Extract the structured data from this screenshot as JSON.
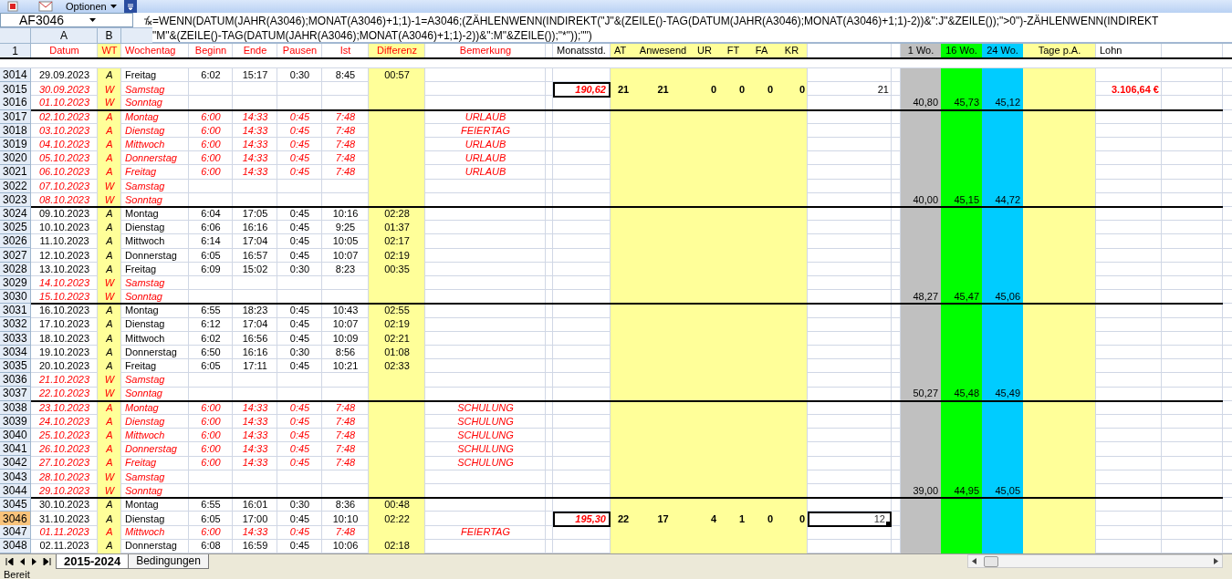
{
  "toolbar": {
    "menu_label": "Optionen"
  },
  "name_box": "AF3046",
  "formula_lines": [
    "=WENN(DATUM(JAHR(A3046);MONAT(A3046)+1;1)-1=A3046;(ZÄHLENWENN(INDIREKT(\"J\"&(ZEILE()-TAG(DATUM(JAHR(A3046);MONAT(A3046)+1;1)-2))&\":J\"&ZEILE());\">0\")-ZÄHLENWENN(INDIREKT",
    "\"M\"&(ZEILE()-TAG(DATUM(JAHR(A3046);MONAT(A3046)+1;1)-2))&\":M\"&ZEILE());\"*\"));\"\")"
  ],
  "column_letters": [
    "A",
    "B"
  ],
  "header_row": "1",
  "headers": [
    "Datum",
    "WT",
    "Wochentag",
    "Beginn",
    "Ende",
    "Pausen",
    "Ist",
    "Differenz",
    "Bemerkung",
    "Monatsstd.",
    "AT",
    "Anwesend",
    "UR",
    "FT",
    "FA",
    "KR",
    "1 Wo.",
    "16 Wo.",
    "24 Wo.",
    "Tage p.A.",
    "Lohn"
  ],
  "rows": [
    {
      "row": "3014",
      "date": "29.09.2023",
      "wt": "A",
      "day": "Freitag",
      "start": "6:02",
      "end": "15:17",
      "break": "0:30",
      "actual": "8:45",
      "diff": "00:57",
      "kind": "work",
      "week_end": false,
      "selected": false
    },
    {
      "row": "3015",
      "date": "30.09.2023",
      "wt": "W",
      "day": "Samstag",
      "kind": "weekend",
      "week_end": false,
      "selected": false,
      "month": {
        "hours": "190,62",
        "at": "21",
        "present": "21",
        "ur": "0",
        "ft": "0",
        "fa": "0",
        "kr": "0",
        "days": "21",
        "wage": "3.106,64 €"
      }
    },
    {
      "row": "3016",
      "date": "01.10.2023",
      "wt": "W",
      "day": "Sonntag",
      "kind": "weekend",
      "week_end": true,
      "selected": false,
      "week": {
        "w1": "40,80",
        "w16": "45,73",
        "w24": "45,12"
      }
    },
    {
      "row": "3017",
      "date": "02.10.2023",
      "wt": "A",
      "day": "Montag",
      "start": "6:00",
      "end": "14:33",
      "break": "0:45",
      "actual": "7:48",
      "note": "URLAUB",
      "kind": "absence",
      "week_end": false,
      "selected": false
    },
    {
      "row": "3018",
      "date": "03.10.2023",
      "wt": "A",
      "day": "Dienstag",
      "start": "6:00",
      "end": "14:33",
      "break": "0:45",
      "actual": "7:48",
      "note": "FEIERTAG",
      "kind": "absence",
      "week_end": false,
      "selected": false
    },
    {
      "row": "3019",
      "date": "04.10.2023",
      "wt": "A",
      "day": "Mittwoch",
      "start": "6:00",
      "end": "14:33",
      "break": "0:45",
      "actual": "7:48",
      "note": "URLAUB",
      "kind": "absence",
      "week_end": false,
      "selected": false
    },
    {
      "row": "3020",
      "date": "05.10.2023",
      "wt": "A",
      "day": "Donnerstag",
      "start": "6:00",
      "end": "14:33",
      "break": "0:45",
      "actual": "7:48",
      "note": "URLAUB",
      "kind": "absence",
      "week_end": false,
      "selected": false
    },
    {
      "row": "3021",
      "date": "06.10.2023",
      "wt": "A",
      "day": "Freitag",
      "start": "6:00",
      "end": "14:33",
      "break": "0:45",
      "actual": "7:48",
      "note": "URLAUB",
      "kind": "absence",
      "week_end": false,
      "selected": false
    },
    {
      "row": "3022",
      "date": "07.10.2023",
      "wt": "W",
      "day": "Samstag",
      "kind": "weekend",
      "week_end": false,
      "selected": false
    },
    {
      "row": "3023",
      "date": "08.10.2023",
      "wt": "W",
      "day": "Sonntag",
      "kind": "weekend",
      "week_end": true,
      "selected": false,
      "week": {
        "w1": "40,00",
        "w16": "45,15",
        "w24": "44,72"
      }
    },
    {
      "row": "3024",
      "date": "09.10.2023",
      "wt": "A",
      "day": "Montag",
      "start": "6:04",
      "end": "17:05",
      "break": "0:45",
      "actual": "10:16",
      "diff": "02:28",
      "kind": "work",
      "week_end": false,
      "selected": false
    },
    {
      "row": "3025",
      "date": "10.10.2023",
      "wt": "A",
      "day": "Dienstag",
      "start": "6:06",
      "end": "16:16",
      "break": "0:45",
      "actual": "9:25",
      "diff": "01:37",
      "kind": "work",
      "week_end": false,
      "selected": false
    },
    {
      "row": "3026",
      "date": "11.10.2023",
      "wt": "A",
      "day": "Mittwoch",
      "start": "6:14",
      "end": "17:04",
      "break": "0:45",
      "actual": "10:05",
      "diff": "02:17",
      "kind": "work",
      "week_end": false,
      "selected": false
    },
    {
      "row": "3027",
      "date": "12.10.2023",
      "wt": "A",
      "day": "Donnerstag",
      "start": "6:05",
      "end": "16:57",
      "break": "0:45",
      "actual": "10:07",
      "diff": "02:19",
      "kind": "work",
      "week_end": false,
      "selected": false
    },
    {
      "row": "3028",
      "date": "13.10.2023",
      "wt": "A",
      "day": "Freitag",
      "start": "6:09",
      "end": "15:02",
      "break": "0:30",
      "actual": "8:23",
      "diff": "00:35",
      "kind": "work",
      "week_end": false,
      "selected": false
    },
    {
      "row": "3029",
      "date": "14.10.2023",
      "wt": "W",
      "day": "Samstag",
      "kind": "weekend",
      "week_end": false,
      "selected": false
    },
    {
      "row": "3030",
      "date": "15.10.2023",
      "wt": "W",
      "day": "Sonntag",
      "kind": "weekend",
      "week_end": true,
      "selected": false,
      "week": {
        "w1": "48,27",
        "w16": "45,47",
        "w24": "45,06"
      }
    },
    {
      "row": "3031",
      "date": "16.10.2023",
      "wt": "A",
      "day": "Montag",
      "start": "6:55",
      "end": "18:23",
      "break": "0:45",
      "actual": "10:43",
      "diff": "02:55",
      "kind": "work",
      "week_end": false,
      "selected": false
    },
    {
      "row": "3032",
      "date": "17.10.2023",
      "wt": "A",
      "day": "Dienstag",
      "start": "6:12",
      "end": "17:04",
      "break": "0:45",
      "actual": "10:07",
      "diff": "02:19",
      "kind": "work",
      "week_end": false,
      "selected": false
    },
    {
      "row": "3033",
      "date": "18.10.2023",
      "wt": "A",
      "day": "Mittwoch",
      "start": "6:02",
      "end": "16:56",
      "break": "0:45",
      "actual": "10:09",
      "diff": "02:21",
      "kind": "work",
      "week_end": false,
      "selected": false
    },
    {
      "row": "3034",
      "date": "19.10.2023",
      "wt": "A",
      "day": "Donnerstag",
      "start": "6:50",
      "end": "16:16",
      "break": "0:30",
      "actual": "8:56",
      "diff": "01:08",
      "kind": "work",
      "week_end": false,
      "selected": false
    },
    {
      "row": "3035",
      "date": "20.10.2023",
      "wt": "A",
      "day": "Freitag",
      "start": "6:05",
      "end": "17:11",
      "break": "0:45",
      "actual": "10:21",
      "diff": "02:33",
      "kind": "work",
      "week_end": false,
      "selected": false
    },
    {
      "row": "3036",
      "date": "21.10.2023",
      "wt": "W",
      "day": "Samstag",
      "kind": "weekend",
      "week_end": false,
      "selected": false
    },
    {
      "row": "3037",
      "date": "22.10.2023",
      "wt": "W",
      "day": "Sonntag",
      "kind": "weekend",
      "week_end": true,
      "selected": false,
      "week": {
        "w1": "50,27",
        "w16": "45,48",
        "w24": "45,49"
      }
    },
    {
      "row": "3038",
      "date": "23.10.2023",
      "wt": "A",
      "day": "Montag",
      "start": "6:00",
      "end": "14:33",
      "break": "0:45",
      "actual": "7:48",
      "note": "SCHULUNG",
      "kind": "absence",
      "week_end": false,
      "selected": false
    },
    {
      "row": "3039",
      "date": "24.10.2023",
      "wt": "A",
      "day": "Dienstag",
      "start": "6:00",
      "end": "14:33",
      "break": "0:45",
      "actual": "7:48",
      "note": "SCHULUNG",
      "kind": "absence",
      "week_end": false,
      "selected": false
    },
    {
      "row": "3040",
      "date": "25.10.2023",
      "wt": "A",
      "day": "Mittwoch",
      "start": "6:00",
      "end": "14:33",
      "break": "0:45",
      "actual": "7:48",
      "note": "SCHULUNG",
      "kind": "absence",
      "week_end": false,
      "selected": false
    },
    {
      "row": "3041",
      "date": "26.10.2023",
      "wt": "A",
      "day": "Donnerstag",
      "start": "6:00",
      "end": "14:33",
      "break": "0:45",
      "actual": "7:48",
      "note": "SCHULUNG",
      "kind": "absence",
      "week_end": false,
      "selected": false
    },
    {
      "row": "3042",
      "date": "27.10.2023",
      "wt": "A",
      "day": "Freitag",
      "start": "6:00",
      "end": "14:33",
      "break": "0:45",
      "actual": "7:48",
      "note": "SCHULUNG",
      "kind": "absence",
      "week_end": false,
      "selected": false
    },
    {
      "row": "3043",
      "date": "28.10.2023",
      "wt": "W",
      "day": "Samstag",
      "kind": "weekend",
      "week_end": false,
      "selected": false
    },
    {
      "row": "3044",
      "date": "29.10.2023",
      "wt": "W",
      "day": "Sonntag",
      "kind": "weekend",
      "week_end": true,
      "selected": false,
      "week": {
        "w1": "39,00",
        "w16": "44,95",
        "w24": "45,05"
      }
    },
    {
      "row": "3045",
      "date": "30.10.2023",
      "wt": "A",
      "day": "Montag",
      "start": "6:55",
      "end": "16:01",
      "break": "0:30",
      "actual": "8:36",
      "diff": "00:48",
      "kind": "work",
      "week_end": false,
      "selected": false
    },
    {
      "row": "3046",
      "date": "31.10.2023",
      "wt": "A",
      "day": "Dienstag",
      "start": "6:05",
      "end": "17:00",
      "break": "0:45",
      "actual": "10:10",
      "diff": "02:22",
      "kind": "work",
      "week_end": false,
      "selected": true,
      "month": {
        "hours": "195,30",
        "at": "22",
        "present": "17",
        "ur": "4",
        "ft": "1",
        "fa": "0",
        "kr": "0",
        "days": "12"
      }
    },
    {
      "row": "3047",
      "date": "01.11.2023",
      "wt": "A",
      "day": "Mittwoch",
      "start": "6:00",
      "end": "14:33",
      "break": "0:45",
      "actual": "7:48",
      "note": "FEIERTAG",
      "kind": "absence",
      "week_end": false,
      "selected": false
    },
    {
      "row": "3048",
      "date": "02.11.2023",
      "wt": "A",
      "day": "Donnerstag",
      "start": "6:08",
      "end": "16:59",
      "break": "0:45",
      "actual": "10:06",
      "diff": "02:18",
      "kind": "work",
      "week_end": false,
      "selected": false
    }
  ],
  "sheet_tabs": [
    {
      "label": "2015-2024",
      "selected": true
    },
    {
      "label": "Bedingungen",
      "selected": false
    }
  ],
  "status_bar": "Bereit"
}
